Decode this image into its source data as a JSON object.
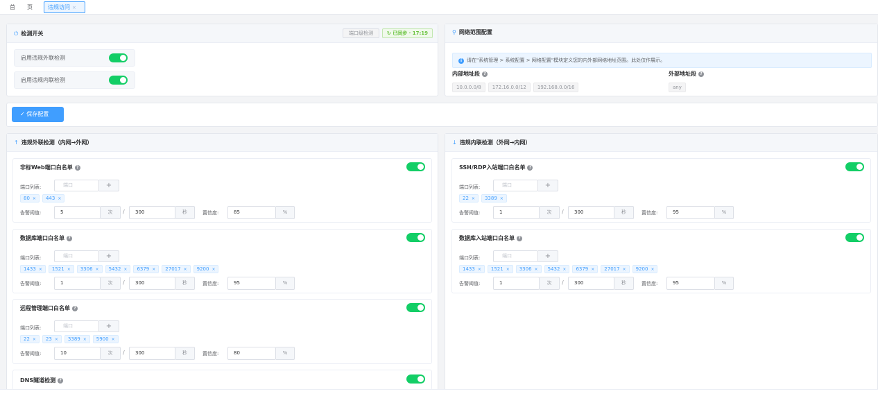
{
  "tabs": {
    "home_1": "首",
    "home_2": "页",
    "active": "违规访问",
    "close": "×"
  },
  "detect": {
    "title": "检测开关",
    "icon": "power-icon",
    "badge_port": "端口级检测",
    "badge_sync": "已同步 · 17:19",
    "switches": [
      {
        "label": "启用违规外联检测",
        "on": true
      },
      {
        "label": "启用违规内联检测",
        "on": true
      }
    ]
  },
  "network": {
    "title": "网络范围配置",
    "info": "请在\"系统管理 > 系统配置 > 网络配置\"模块定义您的内外部网络地址范围。此处仅作展示。",
    "internal_label": "内部地址段",
    "internal": [
      "10.0.0.0/8",
      "172.16.0.0/12",
      "192.168.0.0/16"
    ],
    "external_label": "外部地址段",
    "external": [
      "any"
    ]
  },
  "save_label": "保存配置",
  "outbound": {
    "title": "违规外联检测（内网→外网）",
    "arrow": "↑"
  },
  "inbound": {
    "title": "违规内联检测（外网→内网）",
    "arrow": "↓"
  },
  "common": {
    "port_list": "端口列表:",
    "port_placeholder": "端口",
    "threshold": "告警阈值:",
    "times": "次",
    "seconds": "秒",
    "confidence": "置信度:",
    "percent": "%",
    "slash": "/"
  },
  "rules": {
    "web": {
      "title": "非标Web端口白名单",
      "on": true,
      "ports": [
        "80",
        "443"
      ],
      "count": "5",
      "window": "300",
      "conf": "85"
    },
    "db": {
      "title": "数据库端口白名单",
      "on": true,
      "ports": [
        "1433",
        "1521",
        "3306",
        "5432",
        "6379",
        "27017",
        "9200"
      ],
      "count": "1",
      "window": "300",
      "conf": "95"
    },
    "remote": {
      "title": "远程管理端口白名单",
      "on": true,
      "ports": [
        "22",
        "23",
        "3389",
        "5900"
      ],
      "count": "10",
      "window": "300",
      "conf": "80"
    },
    "dns": {
      "title": "DNS隧道检测",
      "on": true
    },
    "ssh": {
      "title": "SSH/RDP入站端口白名单",
      "on": true,
      "ports": [
        "22",
        "3389"
      ],
      "count": "1",
      "window": "300",
      "conf": "95"
    },
    "dbin": {
      "title": "数据库入站端口白名单",
      "on": true,
      "ports": [
        "1433",
        "1521",
        "3306",
        "5432",
        "6379",
        "27017",
        "9200"
      ],
      "count": "1",
      "window": "300",
      "conf": "95"
    }
  }
}
